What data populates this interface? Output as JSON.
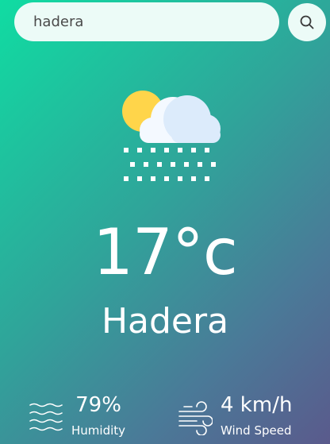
{
  "search": {
    "value": "hadera",
    "icon": "search-icon"
  },
  "weather": {
    "icon": "partly-cloudy-snow-icon",
    "temperature": "17°c",
    "city": "Hadera"
  },
  "humidity": {
    "icon": "humidity-waves-icon",
    "value": "79%",
    "label": "Humidity"
  },
  "wind": {
    "icon": "wind-icon",
    "value": "4 km/h",
    "label": "Wind Speed"
  },
  "colors": {
    "gradient_start": "#10dca2",
    "gradient_end": "#5a5a8c",
    "search_bg": "#ecfbf7",
    "sun": "#ffd54a",
    "cloud": "#e3f0fd"
  }
}
